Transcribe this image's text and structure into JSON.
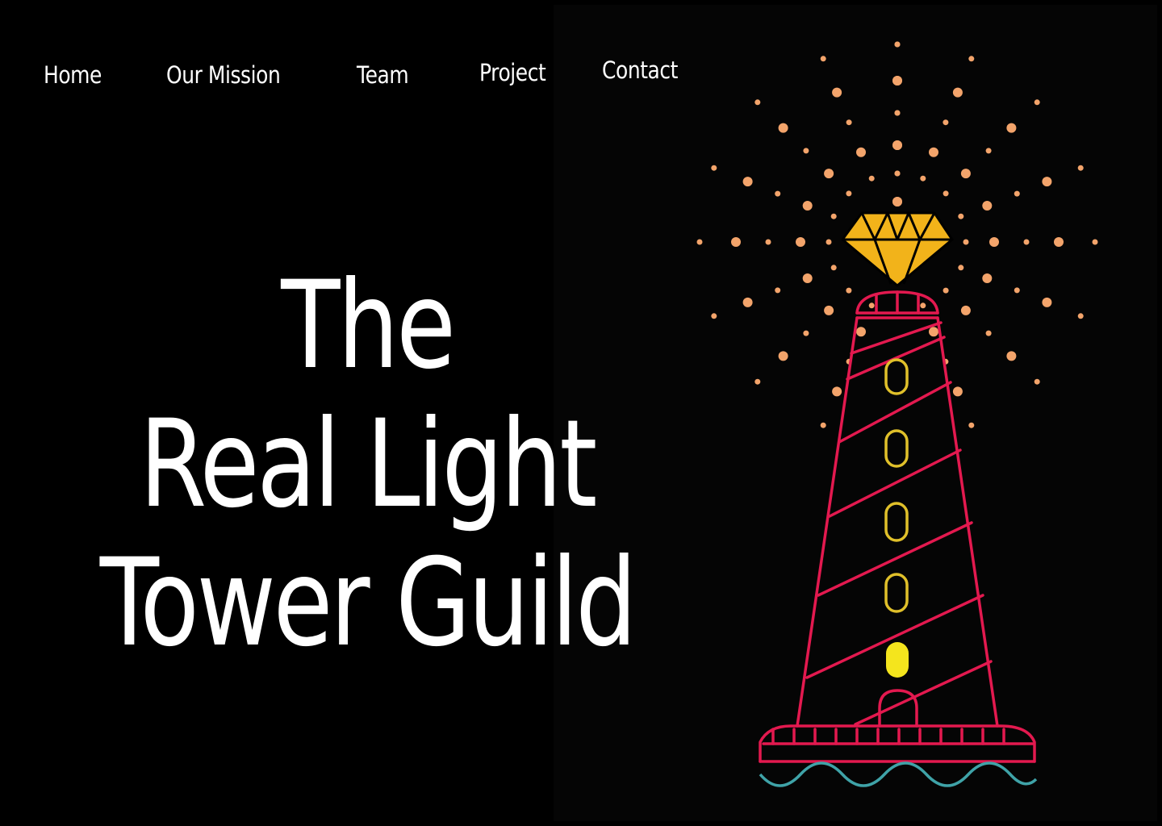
{
  "nav": {
    "items": [
      {
        "label": "Home"
      },
      {
        "label": "Our Mission"
      },
      {
        "label": "Team"
      },
      {
        "label": "Project"
      },
      {
        "label": "Contact"
      }
    ]
  },
  "hero": {
    "lines": [
      "The",
      "Real Light",
      "Tower Guild"
    ]
  },
  "illustration": {
    "icon": "lighthouse-illustration",
    "colors": {
      "tower": "#e3194f",
      "gem": "#f2b31a",
      "windows": "#e0c02a",
      "lit_window": "#f4e51d",
      "rays": "#f3a46b",
      "waves": "#3fa3a8",
      "background": "#000000"
    }
  }
}
